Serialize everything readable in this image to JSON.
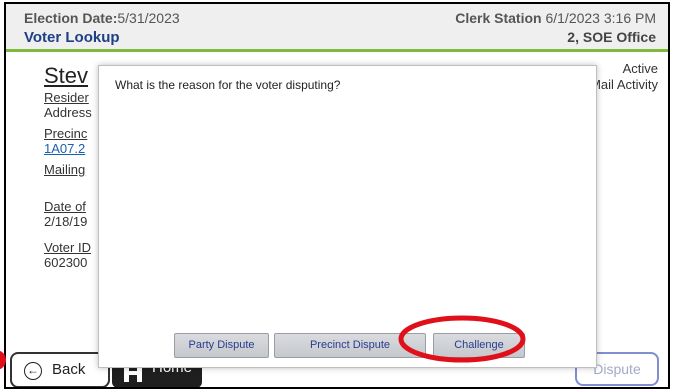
{
  "header": {
    "election_label": "Election Date:",
    "election_value": "5/31/2023",
    "screen_title": "Voter Lookup",
    "station_label": "Clerk Station",
    "station_datetime": "6/1/2023 3:16 PM",
    "station_location": "2, SOE Office"
  },
  "voter": {
    "name": "Stev",
    "residence_label": "Resider",
    "address_value": "Address",
    "precinct_label": "Precinc",
    "precinct_value": "1A07.2",
    "mailing_label": "Mailing",
    "dob_label": "Date of",
    "dob_value": "2/18/19",
    "voter_id_label": "Voter ID",
    "voter_id_value": "602300",
    "status": "Active",
    "mail_activity": "Mail Activity"
  },
  "footer": {
    "back_label": "Back",
    "home_label": "Home",
    "dispute_label": "Dispute"
  },
  "modal": {
    "question": "What is the reason for the voter disputing?",
    "buttons": [
      "Party Dispute",
      "Precinct Dispute",
      "Challenge"
    ]
  },
  "colors": {
    "accent_green": "#7fba3c",
    "title_blue": "#1d3f86",
    "highlight_red": "#e0101a"
  }
}
